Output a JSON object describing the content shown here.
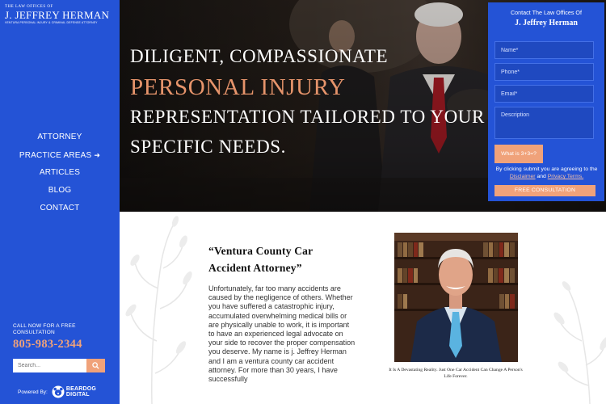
{
  "logo": {
    "small": "THE LAW OFFICES OF",
    "name": "J. JEFFREY HERMAN",
    "tagline": "VENTURA PERSONAL INJURY & CRIMINAL DEFENSE ATTORNEY"
  },
  "nav": {
    "items": [
      "ATTORNEY",
      "PRACTICE AREAS",
      "ARTICLES",
      "BLOG",
      "CONTACT"
    ]
  },
  "sidebar": {
    "call_label": "CALL NOW FOR A FREE CONSULTATION",
    "phone": "805-983-2344",
    "search_placeholder": "Search...",
    "powered_by": "Powered By:",
    "beardog_line1": "BEARDOG",
    "beardog_line2": "DIGITAL"
  },
  "hero": {
    "line1": "DILIGENT, COMPASSIONATE",
    "line2": "PERSONAL INJURY",
    "line3": "REPRESENTATION TAILORED TO YOUR",
    "line4": "SPECIFIC NEEDS."
  },
  "form": {
    "title1": "Contact The Law Offices Of",
    "title2": "J. Jeffrey Herman",
    "name_placeholder": "Name*",
    "phone_placeholder": "Phone*",
    "email_placeholder": "Email*",
    "description_placeholder": "Description",
    "captcha": "What is 3+3=?",
    "disclaimer_prefix": "By clicking submit you are agreeing to the",
    "disclaimer_link": "Disclaimer",
    "disclaimer_and": "and",
    "privacy_link": "Privacy Terms.",
    "submit_label": "FREE CONSULTATION"
  },
  "article": {
    "title": "“Ventura County Car Accident Attorney”",
    "body": "Unfortunately, far too many accidents are caused by the negligence of others. Whether you have suffered a catastrophic injury, accumulated overwhelming medical bills or are physically unable to work, it is important to have an experienced legal advocate on your side to recover the proper compensation you deserve. My name is j. Jeffrey Herman and I am a ventura county car accident attorney. For more than 30 years, I have successfully",
    "caption": "It Is A Devastating Reality. Just One Car Accident Can Change A Person's Life Forever."
  },
  "colors": {
    "brand_blue": "#2453d6",
    "accent_orange": "#f0a27a"
  }
}
